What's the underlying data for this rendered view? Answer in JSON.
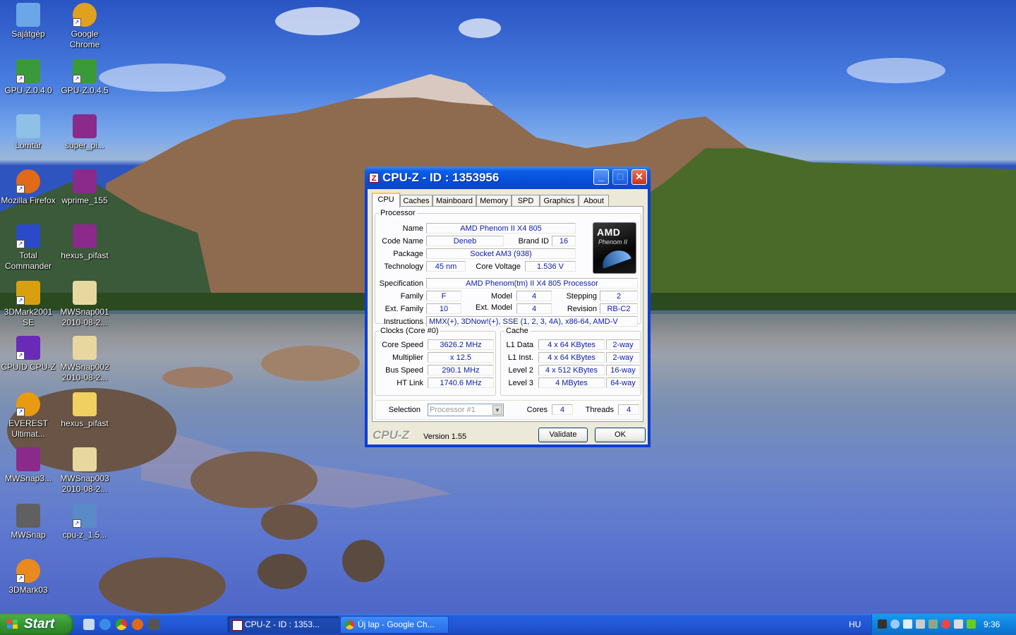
{
  "desktop": {
    "icons": [
      {
        "label": "Sajátgép",
        "color": "#6aa6e8"
      },
      {
        "label": "Google Chrome",
        "color": "#e0a020"
      },
      {
        "label": "GPU-Z.0.4.0",
        "color": "#3a9a3a"
      },
      {
        "label": "GPU-Z.0.4.5",
        "color": "#3a9a3a"
      },
      {
        "label": "Lomtár",
        "color": "#8fc0e8"
      },
      {
        "label": "super_pi...",
        "color": "#8a2a8a"
      },
      {
        "label": "Mozilla Firefox",
        "color": "#e06a1a"
      },
      {
        "label": "wprime_155",
        "color": "#8a2a8a"
      },
      {
        "label": "Total Commander",
        "color": "#2a4ac8"
      },
      {
        "label": "hexus_pifast",
        "color": "#8a2a8a"
      },
      {
        "label": "3DMark2001 SE",
        "color": "#d8a010"
      },
      {
        "label": "MWSnap001 2010-08-2...",
        "color": "#e8d8a0"
      },
      {
        "label": "CPUID CPU-Z",
        "color": "#6a2ab8"
      },
      {
        "label": "MWSnap002 2010-08-2...",
        "color": "#e8d8a0"
      },
      {
        "label": "EVEREST Ultimat...",
        "color": "#e89a10"
      },
      {
        "label": "hexus_pifast",
        "color": "#f0d060"
      },
      {
        "label": "MWSnap3...",
        "color": "#8a2a8a"
      },
      {
        "label": "MWSnap003 2010-08-2...",
        "color": "#e8d8a0"
      },
      {
        "label": "MWSnap",
        "color": "#606060"
      },
      {
        "label": "cpu-z_1.5...",
        "color": "#5a8ac8"
      },
      {
        "label": "3DMark03",
        "color": "#e88a20"
      }
    ]
  },
  "window": {
    "title": "CPU-Z - ID : 1353956",
    "title_icon": "Z",
    "min_label": "_",
    "max_label": "□",
    "close_label": "✕",
    "tabs": [
      "CPU",
      "Caches",
      "Mainboard",
      "Memory",
      "SPD",
      "Graphics",
      "About"
    ],
    "processor": {
      "group_title": "Processor",
      "name_label": "Name",
      "name": "AMD Phenom II X4 805",
      "codename_label": "Code Name",
      "codename": "Deneb",
      "brandid_label": "Brand ID",
      "brandid": "16",
      "package_label": "Package",
      "package": "Socket AM3 (938)",
      "tech_label": "Technology",
      "tech": "45 nm",
      "voltage_label": "Core Voltage",
      "voltage": "1.536 V",
      "spec_label": "Specification",
      "spec": "AMD Phenom(tm) II X4 805 Processor",
      "family_label": "Family",
      "family": "F",
      "model_label": "Model",
      "model": "4",
      "stepping_label": "Stepping",
      "stepping": "2",
      "extfamily_label": "Ext. Family",
      "extfamily": "10",
      "extmodel_label": "Ext. Model",
      "extmodel": "4",
      "revision_label": "Revision",
      "revision": "RB-C2",
      "instr_label": "Instructions",
      "instr": "MMX(+), 3DNow!(+), SSE (1, 2, 3, 4A), x86-64, AMD-V",
      "logo_amd": "AMD",
      "logo_sub": "Phenom II"
    },
    "clocks": {
      "group_title": "Clocks (Core #0)",
      "core_speed_label": "Core Speed",
      "core_speed": "3626.2 MHz",
      "multiplier_label": "Multiplier",
      "multiplier": "x 12.5",
      "bus_speed_label": "Bus Speed",
      "bus_speed": "290.1 MHz",
      "ht_link_label": "HT Link",
      "ht_link": "1740.6 MHz"
    },
    "cache": {
      "group_title": "Cache",
      "l1d_label": "L1 Data",
      "l1d": "4 x 64 KBytes",
      "l1d_way": "2-way",
      "l1i_label": "L1 Inst.",
      "l1i": "4 x 64 KBytes",
      "l1i_way": "2-way",
      "l2_label": "Level 2",
      "l2": "4 x 512 KBytes",
      "l2_way": "16-way",
      "l3_label": "Level 3",
      "l3": "4 MBytes",
      "l3_way": "64-way"
    },
    "selection": {
      "label": "Selection",
      "value": "Processor #1",
      "arrow": "▼",
      "cores_label": "Cores",
      "cores": "4",
      "threads_label": "Threads",
      "threads": "4"
    },
    "footer": {
      "brand": "CPU-Z",
      "version": "Version 1.55",
      "validate_label": "Validate",
      "ok_label": "OK"
    }
  },
  "taskbar": {
    "start_label": "Start",
    "buttons": [
      {
        "label": "CPU-Z - ID : 1353..."
      },
      {
        "label": "Új lap - Google Ch..."
      }
    ],
    "language": "HU",
    "clock": "9:36"
  }
}
